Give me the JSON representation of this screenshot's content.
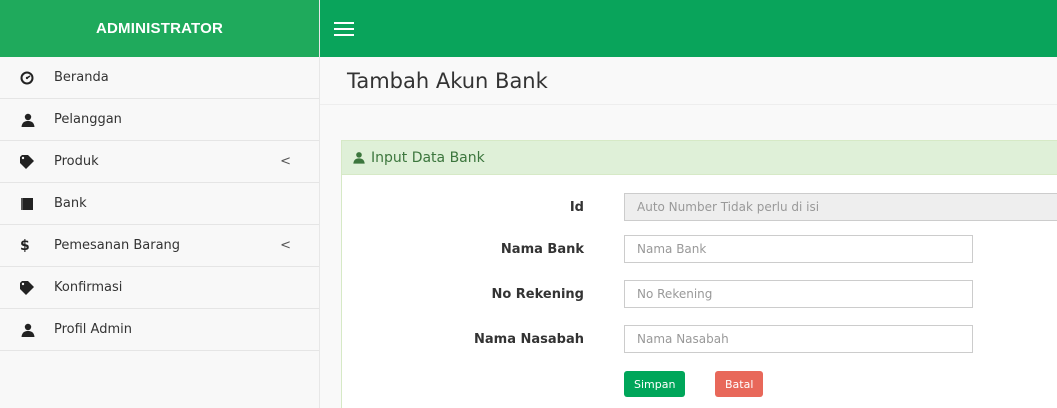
{
  "brand": "ADMINISTRATOR",
  "sidebar": {
    "items": [
      {
        "label": "Beranda",
        "icon": "dashboard-icon",
        "chevron": ""
      },
      {
        "label": "Pelanggan",
        "icon": "user-icon",
        "chevron": ""
      },
      {
        "label": "Produk",
        "icon": "tag-icon",
        "chevron": "<"
      },
      {
        "label": "Bank",
        "icon": "book-icon",
        "chevron": ""
      },
      {
        "label": "Pemesanan Barang",
        "icon": "dollar-icon",
        "chevron": "<"
      },
      {
        "label": "Konfirmasi",
        "icon": "tag-icon",
        "chevron": ""
      },
      {
        "label": "Profil Admin",
        "icon": "user-icon",
        "chevron": ""
      }
    ]
  },
  "page": {
    "title": "Tambah Akun Bank"
  },
  "panel": {
    "heading": "Input Data Bank",
    "icon": "user-icon"
  },
  "form": {
    "id": {
      "label": "Id",
      "placeholder": "Auto Number Tidak perlu di isi",
      "value": ""
    },
    "nama_bank": {
      "label": "Nama Bank",
      "placeholder": "Nama Bank",
      "value": ""
    },
    "no_rekening": {
      "label": "No Rekening",
      "placeholder": "No Rekening",
      "value": ""
    },
    "nama_nasabah": {
      "label": "Nama Nasabah",
      "placeholder": "Nama Nasabah",
      "value": ""
    },
    "save_label": "Simpan",
    "cancel_label": "Batal"
  },
  "colors": {
    "brand_bg": "#1faa5c",
    "topbar_bg": "#09a45b",
    "panel_heading_bg": "#dff0d8",
    "panel_heading_text": "#3c763d",
    "save_button": "#00a65a",
    "cancel_button": "#e8685a"
  }
}
